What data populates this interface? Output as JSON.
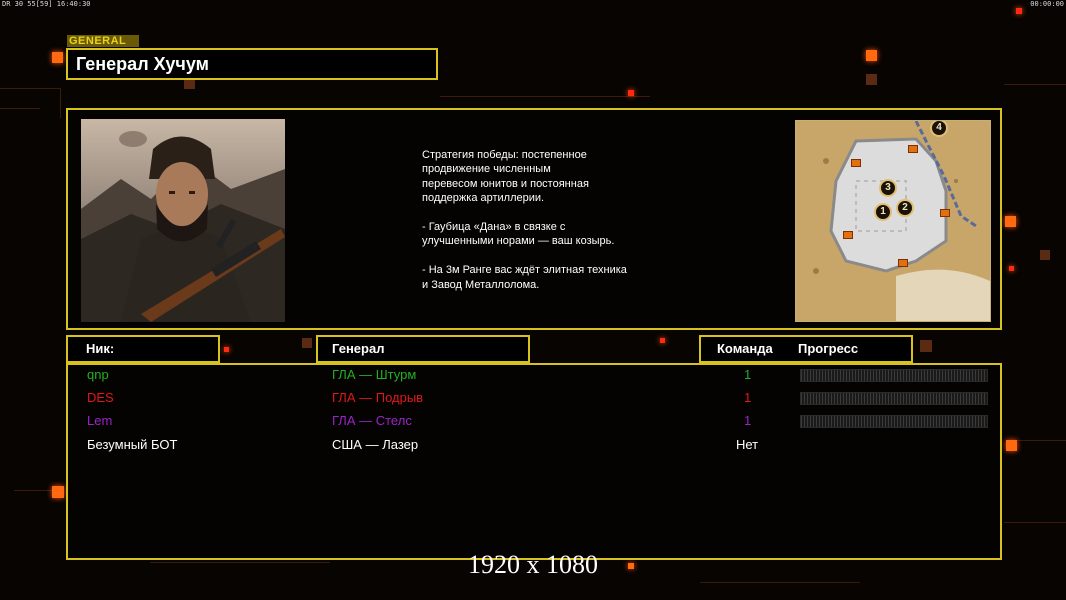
{
  "hud": {
    "left_status": "DR 30 55[59] 16:40:30",
    "right_clock": "00:00:00"
  },
  "general": {
    "tag": "GENERAL",
    "name": "Генерал Хучум"
  },
  "strategy": {
    "text": "Стратегия победы: постепенное\nпродвижение численным\nперевесом юнитов и постоянная\nподдержка артиллерии.\n\n- Гаубица «Дана» в связке с\nулучшенными норами — ваш козырь.\n\n- На 3м Ранге вас ждёт элитная техника\nи Завод Металлолома."
  },
  "minimap": {
    "markers": [
      "1",
      "2",
      "3",
      "4"
    ]
  },
  "table": {
    "headers": {
      "nick": "Ник:",
      "general": "Генерал",
      "team": "Команда",
      "progress": "Прогресс"
    },
    "rows": [
      {
        "nick": "qnp",
        "general": "ГЛА — Штурм",
        "team": "1",
        "color": "#22b022",
        "progress": 0
      },
      {
        "nick": "DES",
        "general": "ГЛА — Подрыв",
        "team": "1",
        "color": "#e01818",
        "progress": 0
      },
      {
        "nick": "Lem",
        "general": "ГЛА — Стелс",
        "team": "1",
        "color": "#9a24c8",
        "progress": 0
      },
      {
        "nick": "Безумный БОТ",
        "general": "США — Лазер",
        "team": "Нет",
        "color": "#ffffff",
        "progress": null
      }
    ]
  },
  "resolution_text": "1920 x 1080",
  "colors": {
    "accent_gold": "#d8c21c",
    "accent_orange": "#ff6a10"
  }
}
